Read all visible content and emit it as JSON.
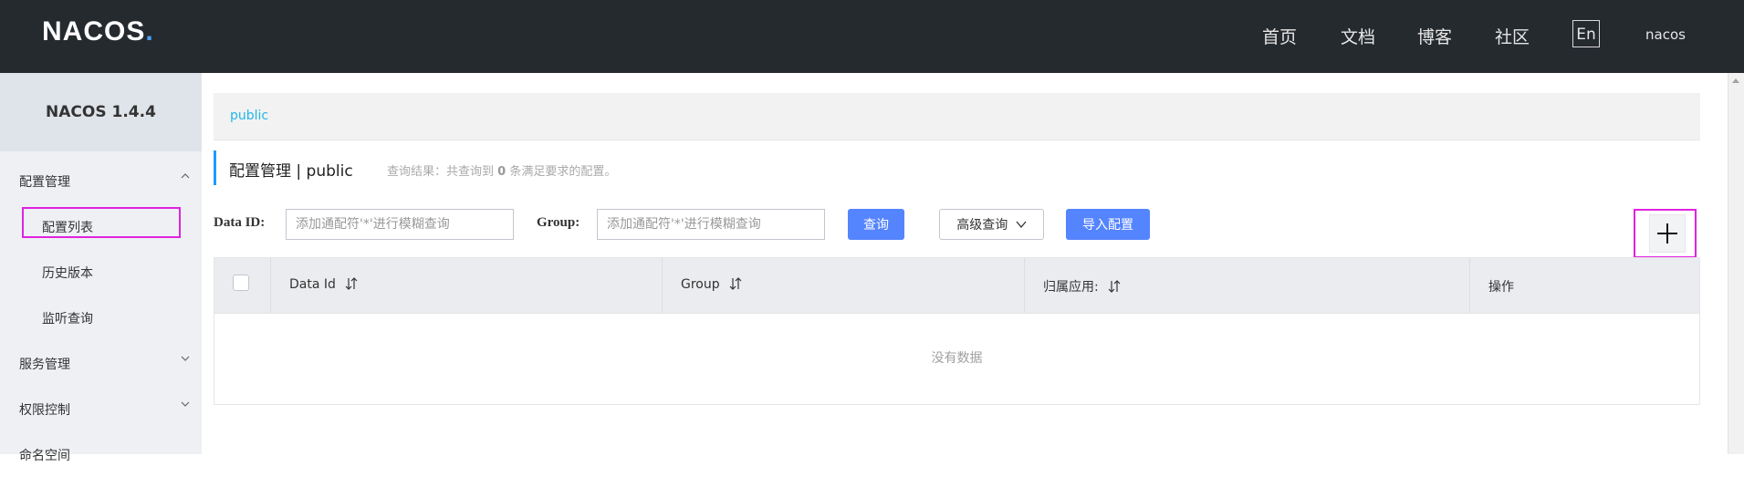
{
  "header": {
    "logo": "NACOS",
    "logo_dot": ".",
    "nav": [
      "首页",
      "文档",
      "博客",
      "社区"
    ],
    "lang": "En",
    "user": "nacos"
  },
  "sidebar": {
    "brand": "NACOS 1.4.4",
    "items": [
      {
        "label": "配置管理",
        "level": 1,
        "expanded": true
      },
      {
        "label": "配置列表",
        "level": 2,
        "active": true
      },
      {
        "label": "历史版本",
        "level": 2
      },
      {
        "label": "监听查询",
        "level": 2
      },
      {
        "label": "服务管理",
        "level": 1,
        "expanded": false
      },
      {
        "label": "权限控制",
        "level": 1,
        "expanded": false
      },
      {
        "label": "命名空间",
        "level": 1
      }
    ]
  },
  "namespace": {
    "current": "public"
  },
  "page": {
    "title": "配置管理 | public",
    "result_prefix": "查询结果：共查询到",
    "result_count": "0",
    "result_suffix": "条满足要求的配置。"
  },
  "filters": {
    "data_id_label": "Data ID:",
    "data_id_placeholder": "添加通配符'*'进行模糊查询",
    "group_label": "Group:",
    "group_placeholder": "添加通配符'*'进行模糊查询",
    "query_button": "查询",
    "advanced_button": "高级查询",
    "import_button": "导入配置",
    "add_icon": "plus-icon"
  },
  "table": {
    "columns": [
      "Data Id",
      "Group",
      "归属应用:",
      "操作"
    ],
    "empty_text": "没有数据"
  },
  "colors": {
    "header_bg": "#252a2f",
    "accent": "#5584ff",
    "link": "#23b7e5",
    "highlight": "#e022e0"
  }
}
